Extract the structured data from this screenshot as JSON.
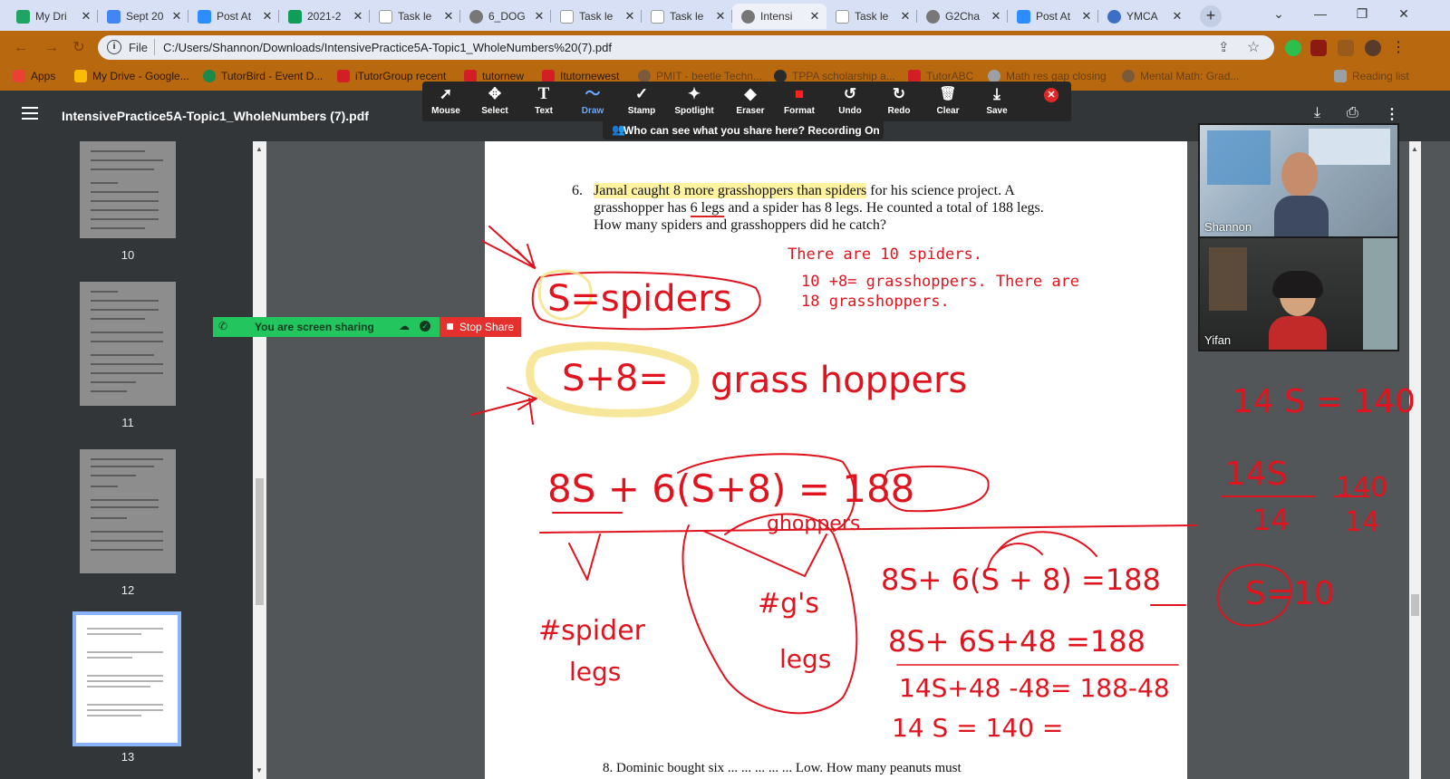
{
  "tabs": [
    {
      "title": "My Dri",
      "color": "#1fa463"
    },
    {
      "title": "Sept 20",
      "color": "#4285f4"
    },
    {
      "title": "Post At",
      "color": "#2d8cff"
    },
    {
      "title": "2021-2",
      "color": "#0f9d58"
    },
    {
      "title": "Task le",
      "color": "#ffffff"
    },
    {
      "title": "6_DOG",
      "color": "#777777"
    },
    {
      "title": "Task le",
      "color": "#ffffff"
    },
    {
      "title": "Task le",
      "color": "#ffffff"
    },
    {
      "title": "Intensi",
      "color": "#777777"
    },
    {
      "title": "Task le",
      "color": "#ffffff"
    },
    {
      "title": "G2Cha",
      "color": "#777777"
    },
    {
      "title": "Post At",
      "color": "#2d8cff"
    },
    {
      "title": "YMCA",
      "color": "#3b6fc6"
    }
  ],
  "address": {
    "scheme_label": "File",
    "url": "C:/Users/Shannon/Downloads/IntensivePractice5A-Topic1_WholeNumbers%20(7).pdf"
  },
  "bookmarks": [
    {
      "label": "Apps",
      "color": "#e94235"
    },
    {
      "label": "My Drive - Google...",
      "color": "#fbbc04"
    },
    {
      "label": "TutorBird - Event D...",
      "color": "#1a8a4a"
    },
    {
      "label": "iTutorGroup recent",
      "color": "#d21f26"
    },
    {
      "label": "tutornew",
      "color": "#d21f26"
    },
    {
      "label": "Itutornewest",
      "color": "#d21f26"
    },
    {
      "label": "PMIT - beetle Techn...",
      "color": "#7a5a3a"
    },
    {
      "label": "TPPA scholarship a...",
      "color": "#2a2a2a"
    },
    {
      "label": "TutorABC",
      "color": "#d21f26"
    },
    {
      "label": "Math res gap closing",
      "color": "#9aa0a6"
    },
    {
      "label": "Mental Math: Grad...",
      "color": "#7a5a3a"
    },
    {
      "label": "Reading list",
      "color": "#9aa0a6"
    }
  ],
  "pdf": {
    "title": "IntensivePractice5A-Topic1_WholeNumbers (7).pdf"
  },
  "annotate": {
    "tools": [
      {
        "label": "Mouse",
        "glyph": "➚"
      },
      {
        "label": "Select",
        "glyph": "✥"
      },
      {
        "label": "Text",
        "glyph": "T"
      },
      {
        "label": "Draw",
        "glyph": "〜"
      },
      {
        "label": "Stamp",
        "glyph": "✓"
      },
      {
        "label": "Spotlight",
        "glyph": "✦"
      },
      {
        "label": "Eraser",
        "glyph": "◆"
      },
      {
        "label": "Format",
        "glyph": "■"
      },
      {
        "label": "Undo",
        "glyph": "↺"
      },
      {
        "label": "Redo",
        "glyph": "↻"
      },
      {
        "label": "Clear",
        "glyph": "🗑"
      },
      {
        "label": "Save",
        "glyph": "⤓"
      }
    ],
    "recording_text": "Who can see what you share here? Recording On"
  },
  "sharing": {
    "status": "You are screen sharing",
    "stop_label": "Stop Share"
  },
  "thumbnails": [
    "10",
    "11",
    "12",
    "13"
  ],
  "question": {
    "number": "6.",
    "line1_highlight": "Jamal caught 8 more grasshoppers than spiders",
    "line1_rest": " for his science project. A",
    "line2_a": "grasshopper has ",
    "line2_ul": "6 legs",
    "line2_b": " and a spider has 8 legs. He counted a total of 188 legs.",
    "line3": "How many spiders and grasshoppers did he catch?",
    "next_fragment": "8.  Dominic bought six ... ... ... ... ...  Low. How many peanuts must"
  },
  "typed_notes": {
    "line1": "There are 10 spiders.",
    "line2": "10 +8= grasshoppers. There are",
    "line3": "18 grasshoppers."
  },
  "handwriting": {
    "s_spiders": "S=spiders",
    "s_plus_8": "S+8=",
    "grasshoppers": "grass hoppers",
    "eq_main": "8S + 6(S+8) = 188",
    "ghoppers": "ghoppers",
    "spider_legs_1": "#spider",
    "spider_legs_2": "legs",
    "gs_legs_1": "#g's",
    "gs_legs_2": "legs",
    "step1": "8S+ 6(S + 8) =188",
    "step2": "8S+ 6S+48 =188",
    "step3": "14S+48 -48= 188-48",
    "step4": "14 S = 140 =",
    "r1": "14 S = 140",
    "r2_num_left": "14S",
    "r2_den_left": "14",
    "r2_num_right": "140",
    "r2_den_right": "14",
    "r3": "S=10"
  },
  "participants": [
    {
      "name": "Shannon"
    },
    {
      "name": "Yifan"
    }
  ]
}
